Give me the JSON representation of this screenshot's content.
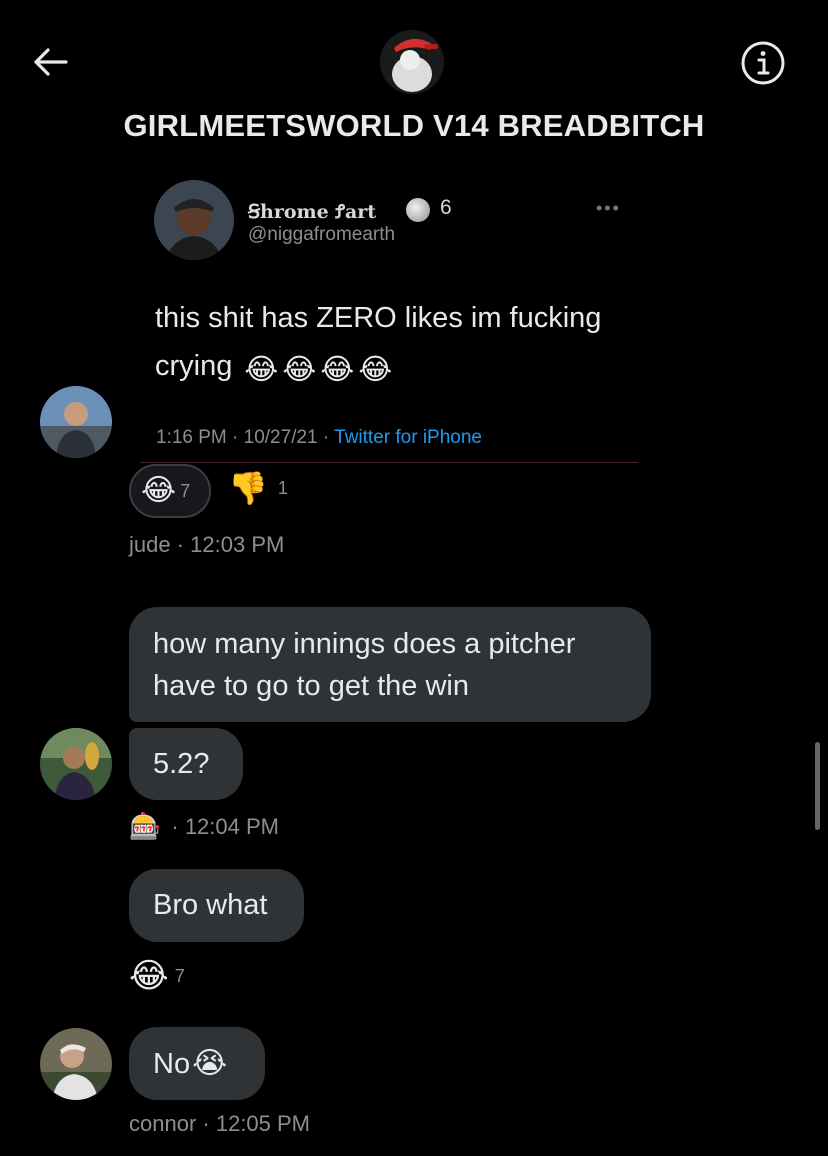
{
  "header": {
    "title": "GIRLMEETSWORLD V14 BREADBITCH",
    "back_icon": "arrow-left-icon",
    "info_icon": "info-circle-icon"
  },
  "shared_tweet": {
    "display_name": "Ꞩhrome Ꝭart",
    "badge_count": "6",
    "handle": "@niggafromearth",
    "text": "this shit has ZERO likes im fucking crying",
    "emojis": [
      "😂",
      "😂",
      "😂",
      "😂"
    ],
    "time": "1:16 PM · 10/27/21 · ",
    "source": "Twitter for iPhone"
  },
  "messages": [
    {
      "reactions": [
        {
          "emoji": "😂",
          "count": "7",
          "selected": true
        },
        {
          "emoji": "👎",
          "count": "1",
          "selected": false
        }
      ],
      "sender": "jude",
      "time": "· 12:03 PM"
    },
    {
      "text": "how many innings does a pitcher have to go to get the win"
    },
    {
      "text": "5.2?",
      "sender_emoji": "🎰",
      "time": "· 12:04 PM"
    },
    {
      "text": "Bro what",
      "reactions": [
        {
          "emoji": "😂",
          "count": "7"
        }
      ]
    },
    {
      "text": "No",
      "emoji": "😭",
      "sender": "connor",
      "time": "· 12:05 PM"
    }
  ],
  "colors": {
    "background": "#000000",
    "bubble": "#2f3336",
    "meta_text": "#8b8f94",
    "link": "#1d9bf0"
  }
}
